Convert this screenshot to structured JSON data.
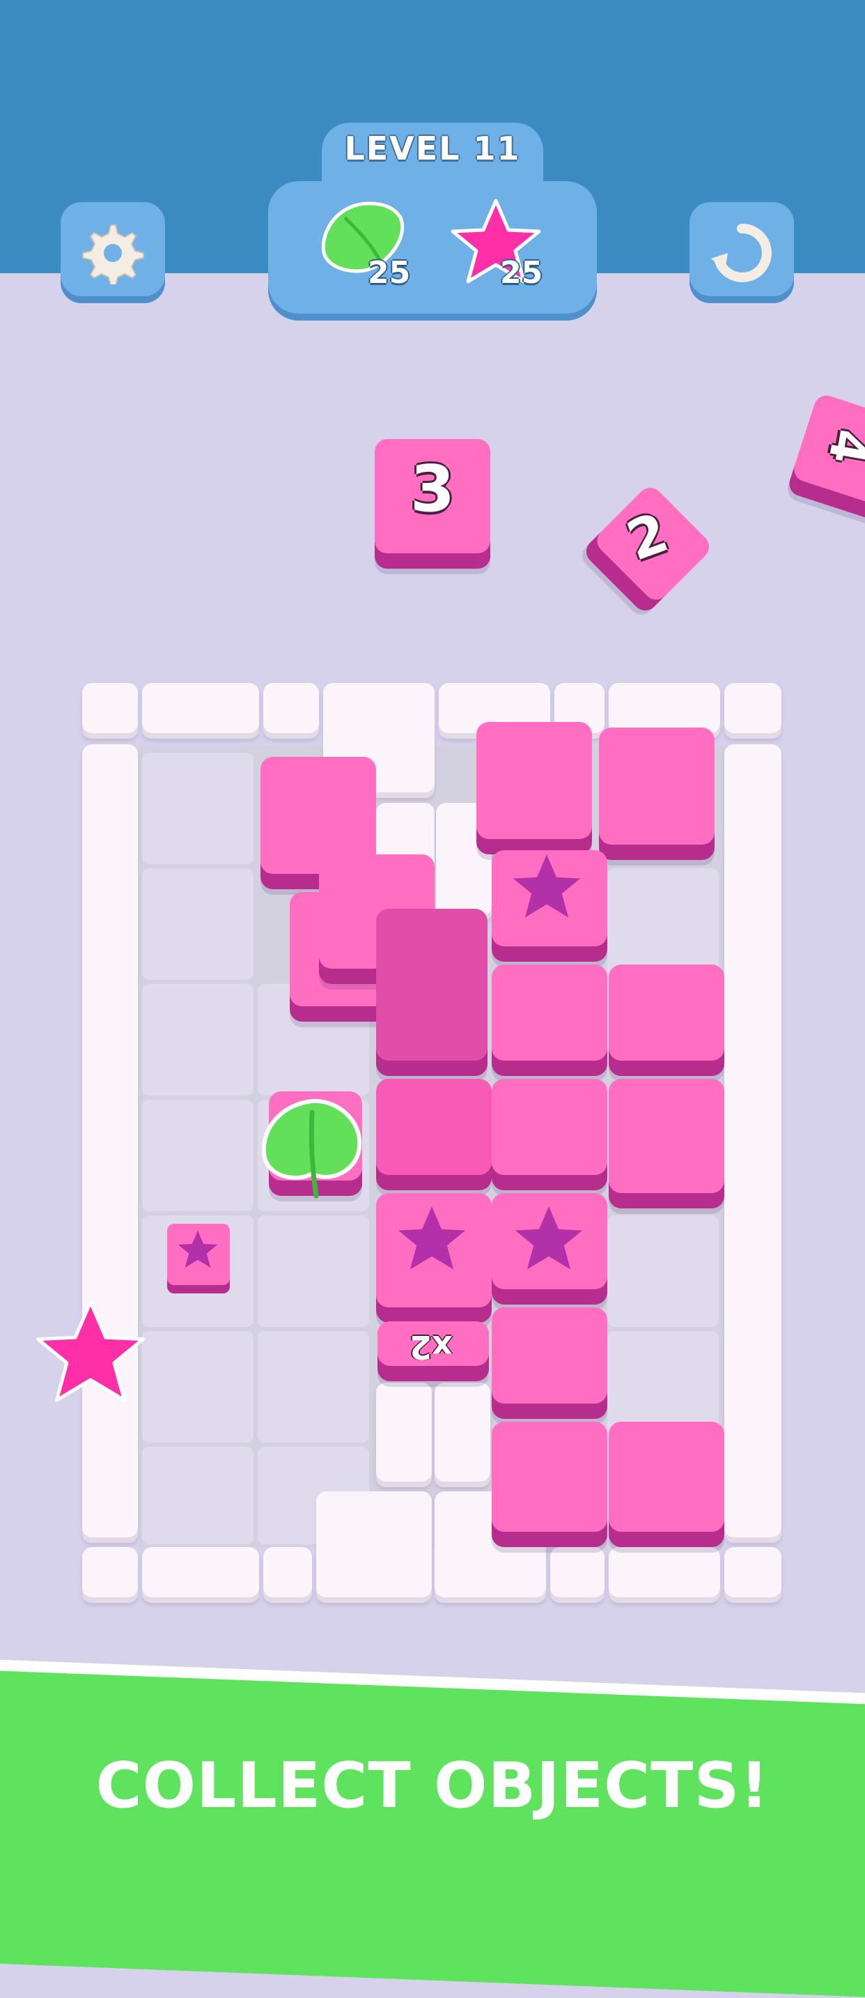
{
  "hud": {
    "level_label": "LEVEL 11",
    "goals": [
      {
        "item": "leaf",
        "count": "25",
        "color": "#62e05a"
      },
      {
        "item": "star",
        "count": "25",
        "color": "#ff2fa8"
      }
    ],
    "settings_icon": "gear-icon",
    "restart_icon": "restart-icon"
  },
  "board": {
    "incoming_tiles": [
      "3",
      "2",
      "4"
    ],
    "multiplier_label": "x2",
    "tile_color": "#ff6ec0"
  },
  "banner": {
    "text": "COLLECT OBJECTS!",
    "color": "#5fe35f"
  }
}
